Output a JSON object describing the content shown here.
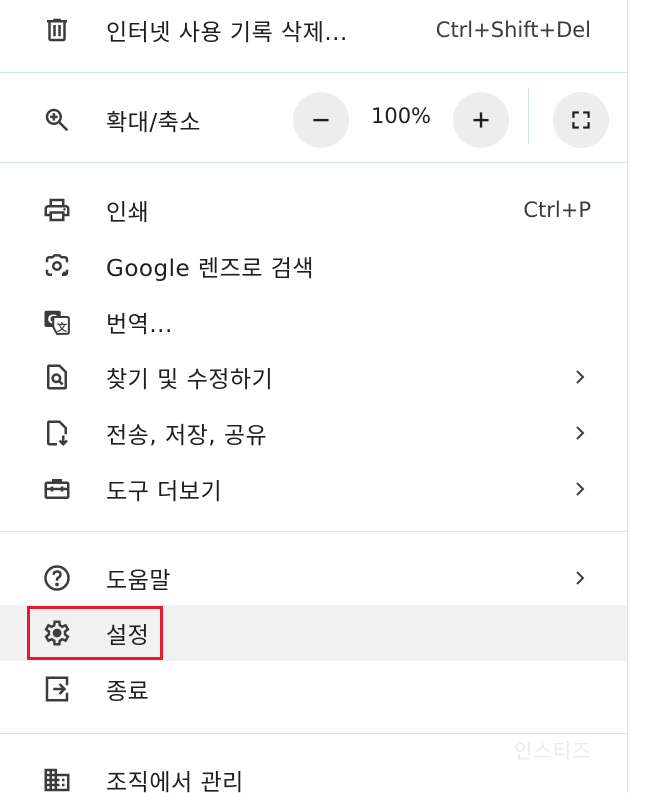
{
  "menu": {
    "clear_history": {
      "label": "인터넷 사용 기록 삭제...",
      "shortcut": "Ctrl+Shift+Del",
      "icon": "trash-icon"
    },
    "zoom": {
      "label": "확대/축소",
      "value": "100%",
      "icon": "zoom-in-icon"
    },
    "print": {
      "label": "인쇄",
      "shortcut": "Ctrl+P",
      "icon": "printer-icon"
    },
    "lens": {
      "label": "Google 렌즈로 검색",
      "icon": "google-lens-icon"
    },
    "translate": {
      "label": "번역...",
      "icon": "translate-icon"
    },
    "find_edit": {
      "label": "찾기 및 수정하기",
      "icon": "find-page-icon"
    },
    "cast_save_share": {
      "label": "전송, 저장, 공유",
      "icon": "file-download-icon"
    },
    "more_tools": {
      "label": "도구 더보기",
      "icon": "toolbox-icon"
    },
    "help": {
      "label": "도움말",
      "icon": "help-circle-icon"
    },
    "settings": {
      "label": "설정",
      "icon": "gear-icon"
    },
    "exit": {
      "label": "종료",
      "icon": "exit-icon"
    },
    "managed": {
      "label": "조직에서 관리",
      "icon": "building-icon"
    }
  },
  "watermark": "인스티즈",
  "colors": {
    "highlight": "#f1f1f1",
    "annotation": "#e51c2c",
    "divider": "#d3e3fd"
  }
}
